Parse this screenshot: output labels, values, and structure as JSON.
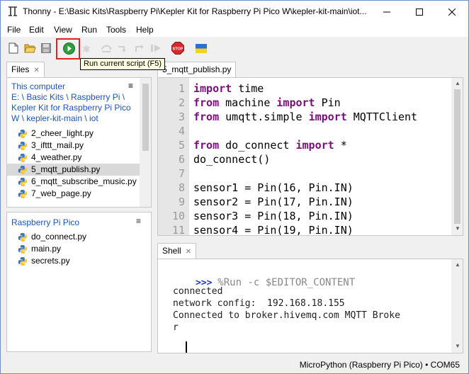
{
  "window": {
    "title": "Thonny  -  E:\\Basic Kits\\Raspberry Pi\\Kepler Kit for Raspberry Pi Pico W\\kepler-kit-main\\iot..."
  },
  "menu": [
    "File",
    "Edit",
    "View",
    "Run",
    "Tools",
    "Help"
  ],
  "toolbar": {
    "tooltip": "Run current script (F5)",
    "stop_label": "STOP",
    "accent_run": "#2e9e3e",
    "highlight": "#e52222"
  },
  "files_panel": {
    "tab_label": "Files",
    "section_this_computer": "This computer",
    "path_lines": [
      "E: \\ Basic Kits \\ Raspberry Pi \\",
      "Kepler Kit for Raspberry Pi Pico",
      "W \\ kepler-kit-main \\ iot"
    ],
    "files": [
      {
        "name": "2_cheer_light.py",
        "selected": false
      },
      {
        "name": "3_ifttt_mail.py",
        "selected": false
      },
      {
        "name": "4_weather.py",
        "selected": false
      },
      {
        "name": "5_mqtt_publish.py",
        "selected": true
      },
      {
        "name": "6_mqtt_subscribe_music.py",
        "selected": false
      },
      {
        "name": "7_web_page.py",
        "selected": false
      }
    ],
    "section_pico": "Raspberry Pi Pico",
    "pico_files": [
      "do_connect.py",
      "main.py",
      "secrets.py"
    ],
    "menu_glyph": "≡"
  },
  "editor": {
    "tab_label": "5_mqtt_publish.py",
    "line_numbers": [
      "1",
      "2",
      "3",
      "4",
      "5",
      "6",
      "7",
      "8",
      "9",
      "10",
      "11"
    ],
    "lines": [
      [
        {
          "t": "import",
          "k": true
        },
        {
          "t": " time",
          "k": false
        }
      ],
      [
        {
          "t": "from",
          "k": true
        },
        {
          "t": " machine ",
          "k": false
        },
        {
          "t": "import",
          "k": true
        },
        {
          "t": " Pin",
          "k": false
        }
      ],
      [
        {
          "t": "from",
          "k": true
        },
        {
          "t": " umqtt.simple ",
          "k": false
        },
        {
          "t": "import",
          "k": true
        },
        {
          "t": " MQTTClient",
          "k": false
        }
      ],
      [],
      [
        {
          "t": "from",
          "k": true
        },
        {
          "t": " do_connect ",
          "k": false
        },
        {
          "t": "import",
          "k": true
        },
        {
          "t": " *",
          "k": false
        }
      ],
      [
        {
          "t": "do_connect()",
          "k": false
        }
      ],
      [],
      [
        {
          "t": "sensor1 = Pin(16, Pin.IN)",
          "k": false
        }
      ],
      [
        {
          "t": "sensor2 = Pin(17, Pin.IN)",
          "k": false
        }
      ],
      [
        {
          "t": "sensor3 = Pin(18, Pin.IN)",
          "k": false
        }
      ],
      [
        {
          "t": "sensor4 = Pin(19, Pin.IN)",
          "k": false
        }
      ]
    ],
    "keyword_color": "#7a0d7a"
  },
  "shell": {
    "tab_label": "Shell",
    "prompt": ">>>",
    "command": "%Run -c $EDITOR_CONTENT",
    "output": [
      "connected",
      "network config:  192.168.18.155",
      "Connected to broker.hivemq.com MQTT Broke",
      "r"
    ]
  },
  "status": {
    "text": "MicroPython (Raspberry Pi Pico)  •  COM65"
  }
}
